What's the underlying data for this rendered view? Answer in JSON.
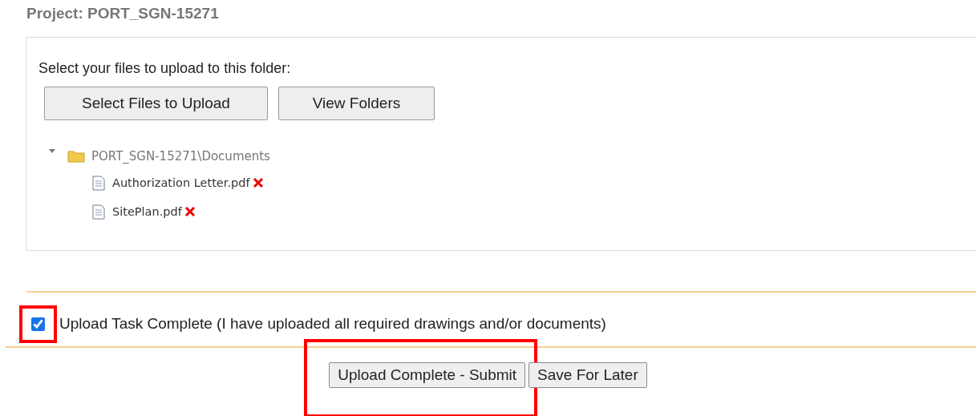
{
  "project_title": "Project: PORT_SGN-15271",
  "upload_panel": {
    "prompt": "Select your files to upload to this folder:",
    "buttons": [
      "Select Files to Upload",
      "View Folders"
    ],
    "tree": [
      {
        "label": "PORT_SGN-15271\\Documents",
        "expanded": true,
        "kind": "folder",
        "children": [
          {
            "label": "Authorization Letter.pdf",
            "kind": "file"
          },
          {
            "label": "SitePlan.pdf",
            "kind": "file"
          }
        ]
      }
    ]
  },
  "task_checkbox": {
    "label": "Upload Task Complete (I have uploaded all required drawings and/or documents)",
    "checked": true,
    "highlighted": true
  },
  "actions": [
    {
      "label": "Upload Complete - Submit",
      "highlighted": true
    },
    {
      "label": "Save For Later",
      "highlighted": false
    }
  ]
}
